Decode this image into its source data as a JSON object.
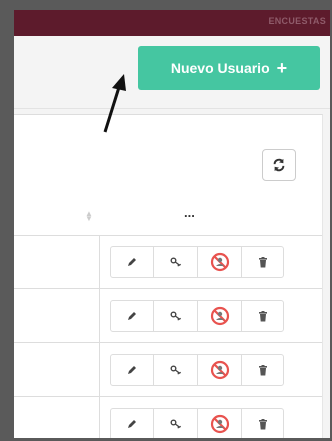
{
  "topbar": {
    "brand": "ENCUESTAS"
  },
  "header": {
    "new_user_label": "Nuevo Usuario",
    "new_user_icon": "+"
  },
  "table": {
    "actions_header": "...",
    "rows": [
      {
        "actions": [
          "edit-icon",
          "key-icon",
          "disable-icon",
          "trash-icon"
        ]
      },
      {
        "actions": [
          "edit-icon",
          "key-icon",
          "disable-icon",
          "trash-icon"
        ]
      },
      {
        "actions": [
          "edit-icon",
          "key-icon",
          "disable-icon",
          "trash-icon"
        ]
      },
      {
        "actions": [
          "edit-icon",
          "key-icon",
          "disable-icon",
          "trash-icon"
        ]
      }
    ]
  },
  "colors": {
    "brand_bar": "#5d1b2c",
    "primary_button": "#45c6a1",
    "disable_icon": "#e8534f"
  }
}
